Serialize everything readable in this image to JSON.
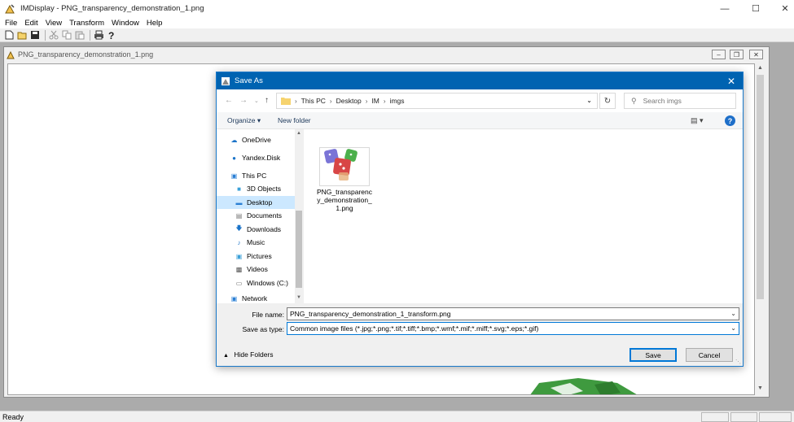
{
  "app": {
    "title": "IMDisplay - PNG_transparency_demonstration_1.png",
    "menu": [
      "File",
      "Edit",
      "View",
      "Transform",
      "Window",
      "Help"
    ],
    "status": "Ready"
  },
  "child_window": {
    "title": "PNG_transparency_demonstration_1.png"
  },
  "dialog": {
    "title": "Save As",
    "breadcrumb": [
      "This PC",
      "Desktop",
      "IM",
      "imgs"
    ],
    "search_placeholder": "Search imgs",
    "organize_label": "Organize ▾",
    "new_folder_label": "New folder",
    "nav_items": [
      {
        "label": "OneDrive",
        "icon": "cloud-icon"
      },
      {
        "label": "Yandex.Disk",
        "icon": "yandex-disk-icon"
      },
      {
        "label": "This PC",
        "icon": "computer-icon"
      },
      {
        "label": "3D Objects",
        "icon": "3d-objects-icon"
      },
      {
        "label": "Desktop",
        "icon": "desktop-icon",
        "selected": true
      },
      {
        "label": "Documents",
        "icon": "documents-icon"
      },
      {
        "label": "Downloads",
        "icon": "downloads-icon"
      },
      {
        "label": "Music",
        "icon": "music-icon"
      },
      {
        "label": "Pictures",
        "icon": "pictures-icon"
      },
      {
        "label": "Videos",
        "icon": "videos-icon"
      },
      {
        "label": "Windows (C:)",
        "icon": "drive-icon"
      },
      {
        "label": "Network",
        "icon": "network-icon"
      }
    ],
    "files": [
      {
        "name": "PNG_transparency_demonstration_1.png"
      }
    ],
    "file_name_label": "File name:",
    "file_name_value": "PNG_transparency_demonstration_1_transform.png",
    "save_type_label": "Save as type:",
    "save_type_value": "Common image files (*.jpg;*.png;*.tif;*.tiff;*.bmp;*.wmf;*.mif;*.miff;*.svg;*.eps;*.gif)",
    "hide_folders_label": "Hide Folders",
    "save_label": "Save",
    "cancel_label": "Cancel"
  },
  "colors": {
    "dialog_title_bg": "#0063b1",
    "selection_bg": "#cce8ff",
    "accent": "#0078d7"
  }
}
